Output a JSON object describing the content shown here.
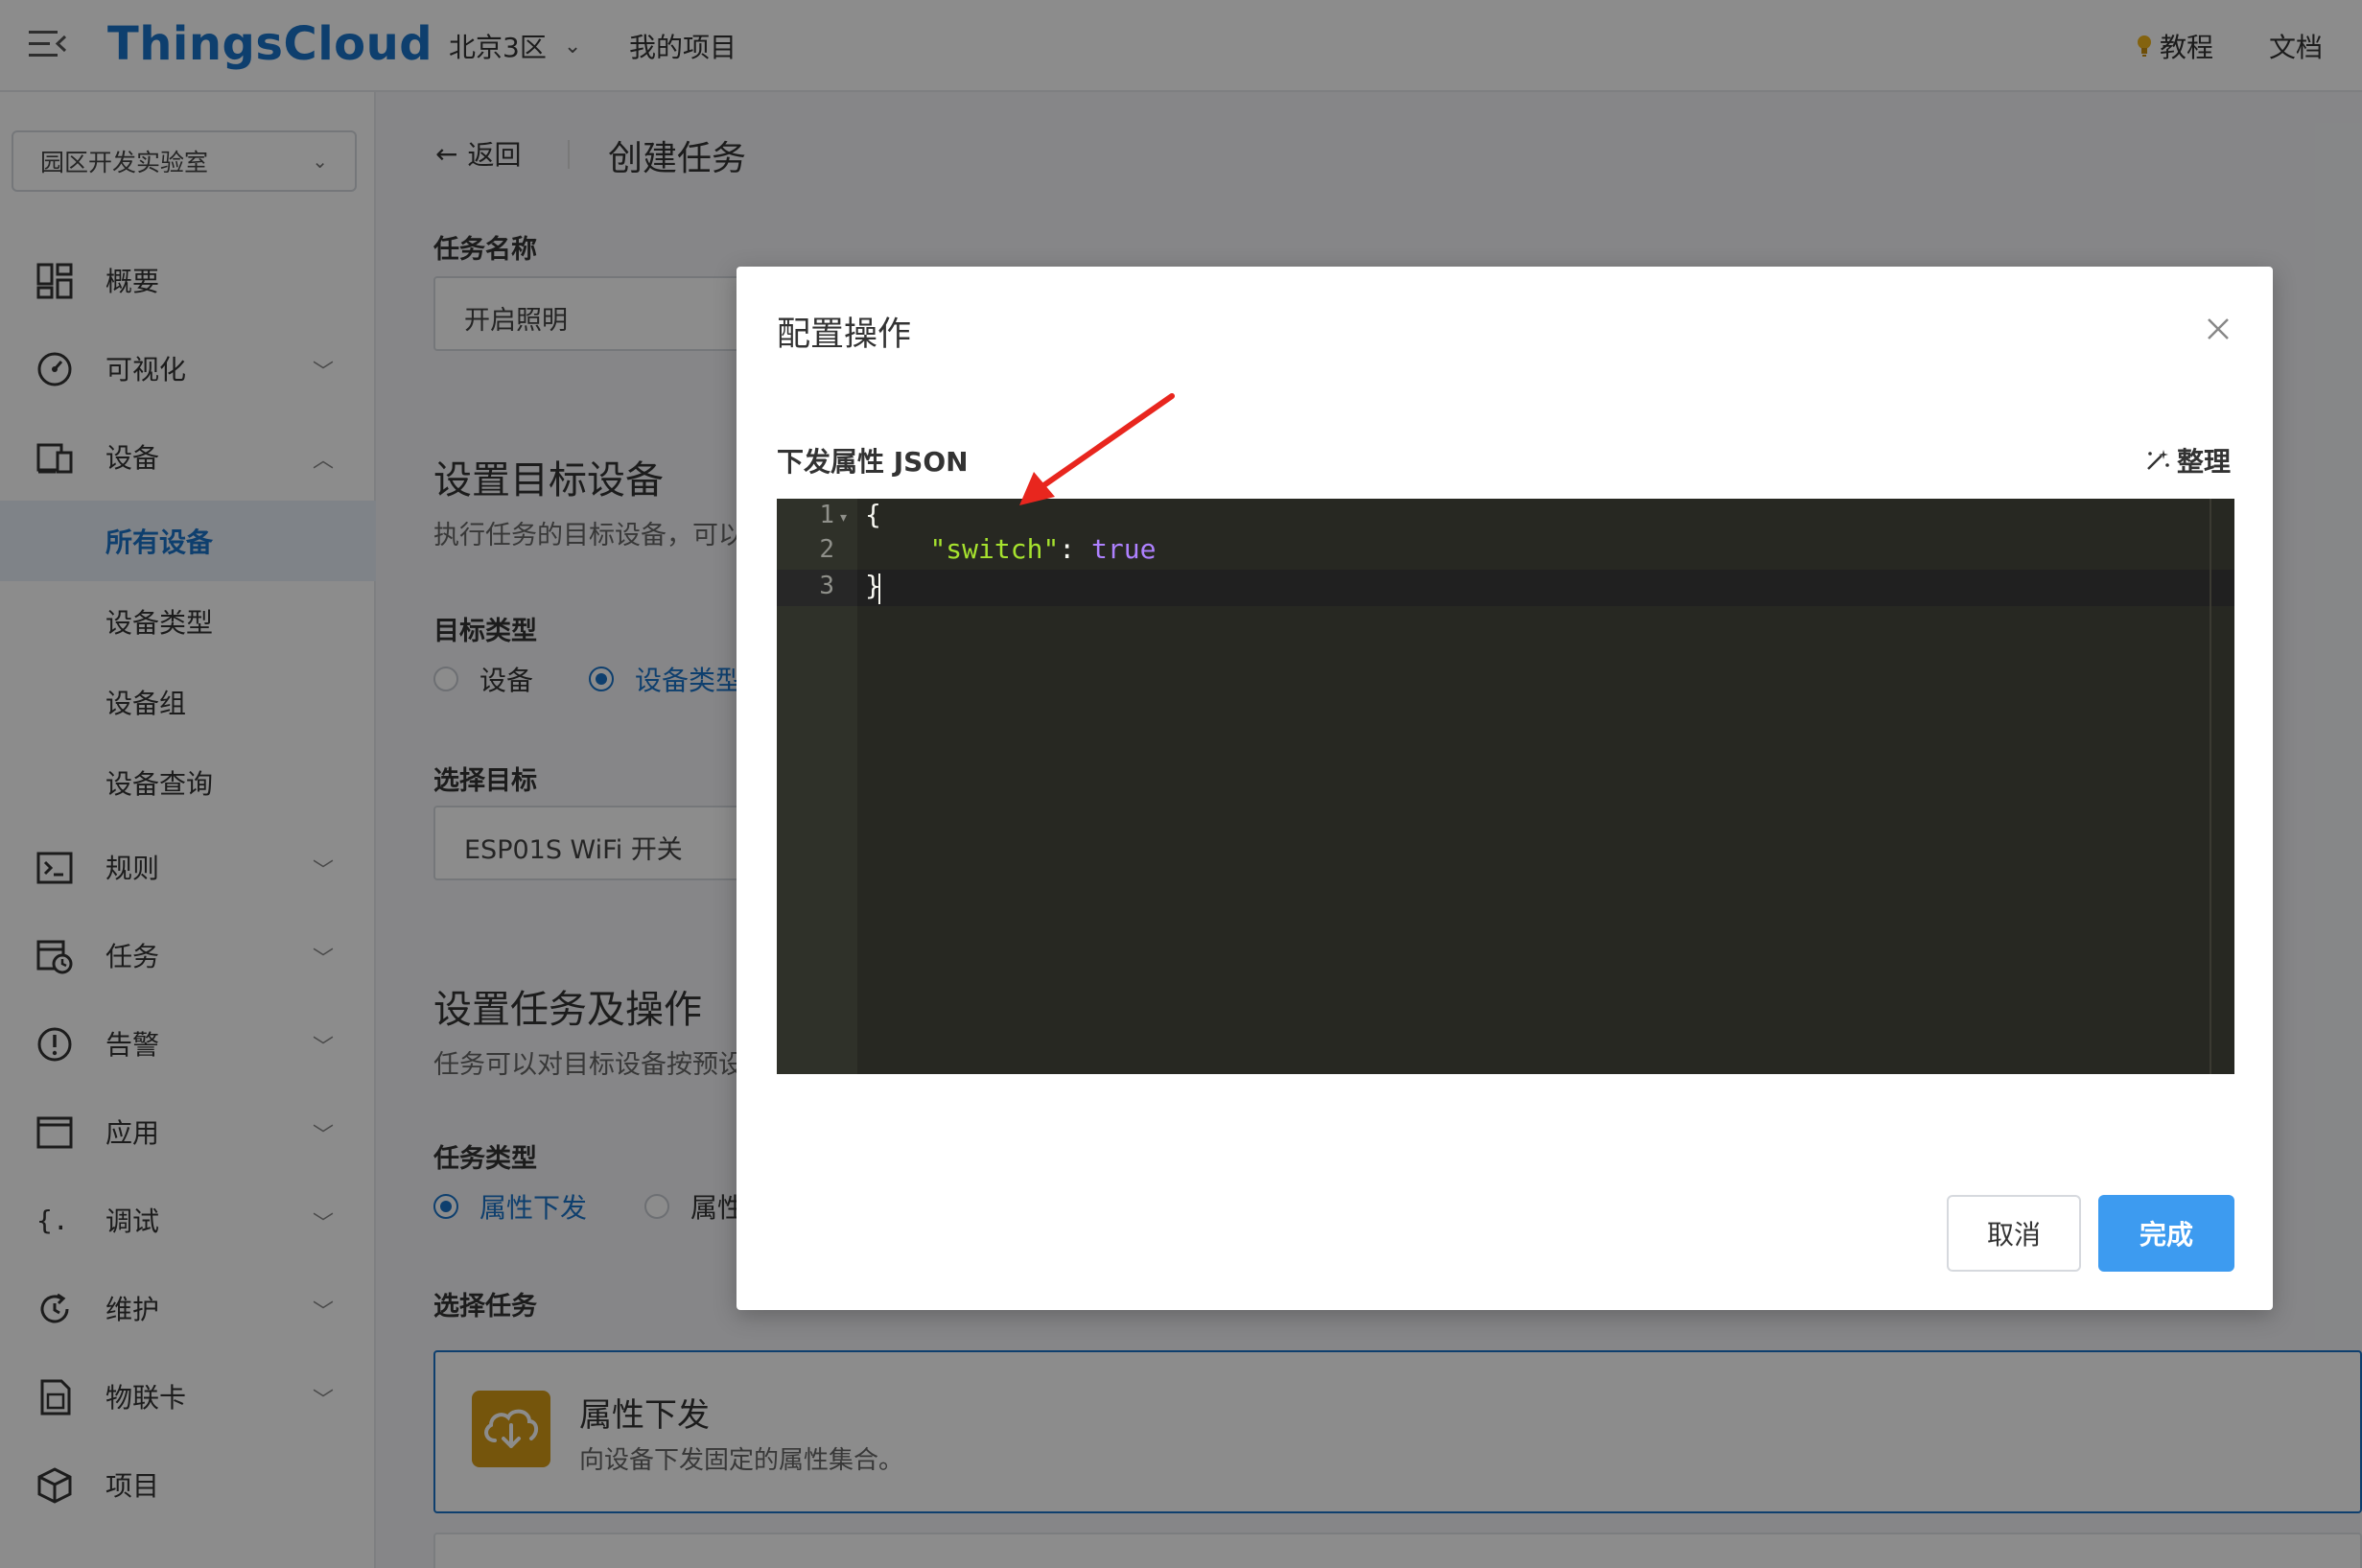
{
  "header": {
    "brand": "ThingsCloud",
    "region": "北京3区",
    "my_projects": "我的项目",
    "tutorial": "教程",
    "docs": "文档"
  },
  "sidebar": {
    "project": "园区开发实验室",
    "items": [
      {
        "label": "概要",
        "icon": "dashboard-icon",
        "chevron": ""
      },
      {
        "label": "可视化",
        "icon": "gauge-icon",
        "chevron": "down"
      },
      {
        "label": "设备",
        "icon": "devices-icon",
        "chevron": "up"
      },
      {
        "label": "规则",
        "icon": "terminal-icon",
        "chevron": "down"
      },
      {
        "label": "任务",
        "icon": "task-clock-icon",
        "chevron": "down"
      },
      {
        "label": "告警",
        "icon": "alert-icon",
        "chevron": "down"
      },
      {
        "label": "应用",
        "icon": "window-icon",
        "chevron": "down"
      },
      {
        "label": "调试",
        "icon": "braces-icon",
        "chevron": "down"
      },
      {
        "label": "维护",
        "icon": "refresh-icon",
        "chevron": "down"
      },
      {
        "label": "物联卡",
        "icon": "sim-card-icon",
        "chevron": "down"
      },
      {
        "label": "项目",
        "icon": "cube-icon",
        "chevron": ""
      }
    ],
    "device_subitems": [
      {
        "label": "所有设备",
        "active": true
      },
      {
        "label": "设备类型",
        "active": false
      },
      {
        "label": "设备组",
        "active": false
      },
      {
        "label": "设备查询",
        "active": false
      }
    ]
  },
  "main": {
    "back": "返回",
    "title": "创建任务",
    "task_name_label": "任务名称",
    "task_name_value": "开启照明",
    "target_section_title": "设置目标设备",
    "target_section_desc": "执行任务的目标设备，可以",
    "target_type_label": "目标类型",
    "target_type_options": [
      "设备",
      "设备类型"
    ],
    "target_type_selected": 1,
    "select_target_label": "选择目标",
    "select_target_value": "ESP01S WiFi 开关",
    "task_section_title": "设置任务及操作",
    "task_section_desc": "任务可以对目标设备按预设",
    "task_type_label": "任务类型",
    "task_type_options": [
      "属性下发",
      "属性"
    ],
    "task_type_selected": 0,
    "select_task_label": "选择任务",
    "task_card_title": "属性下发",
    "task_card_desc": "向设备下发固定的属性集合。"
  },
  "modal": {
    "title": "配置操作",
    "json_label": "下发属性 JSON",
    "format_label": "整理",
    "code_lines": [
      {
        "n": "1",
        "text": "{"
      },
      {
        "n": "2",
        "key": "\"switch\"",
        "sep": ": ",
        "value": "true"
      },
      {
        "n": "3",
        "text": "}"
      }
    ],
    "cancel": "取消",
    "done": "完成"
  },
  "colors": {
    "brand": "#1a73c8",
    "primary_button": "#3d9bf0",
    "editor_bg": "#272822",
    "json_key": "#a6e22e",
    "json_bool": "#ae81ff",
    "annotation_arrow": "#e8261e",
    "task_icon_bg": "#d69b16"
  }
}
